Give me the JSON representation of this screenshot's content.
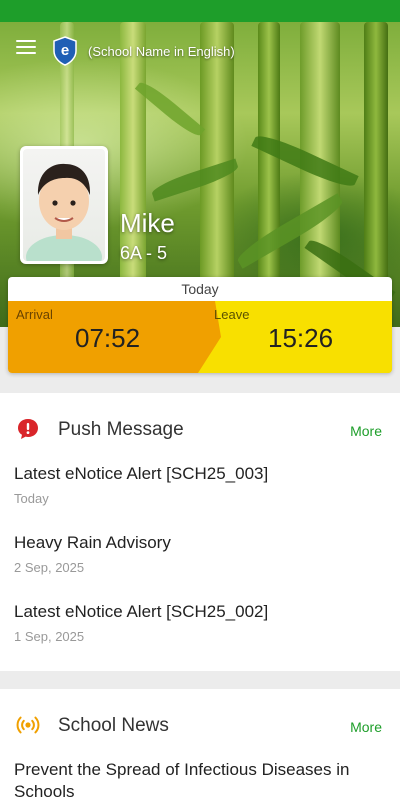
{
  "header": {
    "school_name": "(School Name in English)",
    "menu_icon": "hamburger-menu-icon",
    "logo_letter": "e"
  },
  "student": {
    "name": "Mike",
    "class": "6A - 5"
  },
  "attendance": {
    "today_label": "Today",
    "arrival_label": "Arrival",
    "arrival_time": "07:52",
    "leave_label": "Leave",
    "leave_time": "15:26",
    "colors": {
      "arrival": "#f0a000",
      "leave": "#f8e000"
    }
  },
  "push_message": {
    "title": "Push Message",
    "more": "More",
    "icon": "alert-bubble-icon",
    "items": [
      {
        "title": "Latest eNotice Alert [SCH25_003]",
        "date": "Today"
      },
      {
        "title": "Heavy Rain Advisory",
        "date": "2 Sep, 2025"
      },
      {
        "title": "Latest eNotice Alert [SCH25_002]",
        "date": "1 Sep, 2025"
      }
    ]
  },
  "school_news": {
    "title": "School News",
    "more": "More",
    "icon": "broadcast-icon",
    "items": [
      {
        "title": "Prevent the Spread of Infectious Diseases in Schools"
      }
    ]
  },
  "colors": {
    "accent": "#1e9e2a",
    "alert": "#d9252a",
    "news_icon": "#f0a000"
  }
}
